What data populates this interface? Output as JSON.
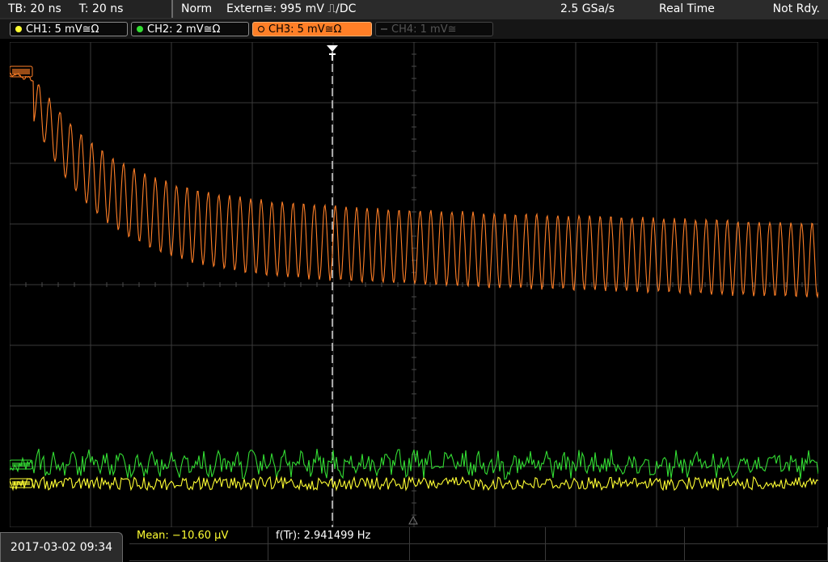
{
  "topbar": {
    "timebase": "TB: 20 ns",
    "trigger_time": "T: 20 ns",
    "mode": "Norm",
    "trigger_source": "Extern≅: 995 mV ⎍/DC",
    "sample_rate": "2.5 GSa/s",
    "acquisition": "Real Time",
    "status": "Not Rdy."
  },
  "channels": [
    {
      "label": "CH1: 5 mV≅Ω",
      "color": "#ffff33"
    },
    {
      "label": "CH2: 2 mV≅Ω",
      "color": "#33dd33"
    },
    {
      "label": "CH3: 5 mV≅Ω",
      "color": "#ff7f27"
    },
    {
      "label": "CH4: 1 mV≅",
      "color": "#555555"
    }
  ],
  "bottombar": {
    "datetime": "2017-03-02 09:34",
    "mean": "Mean: −10.60 µV",
    "frequency": "f(Tr): 2.941499 Hz"
  },
  "waveforms": {
    "ch3_color": "#ff7f27",
    "ch2_color": "#33dd33",
    "ch1_color": "#ffff33"
  }
}
